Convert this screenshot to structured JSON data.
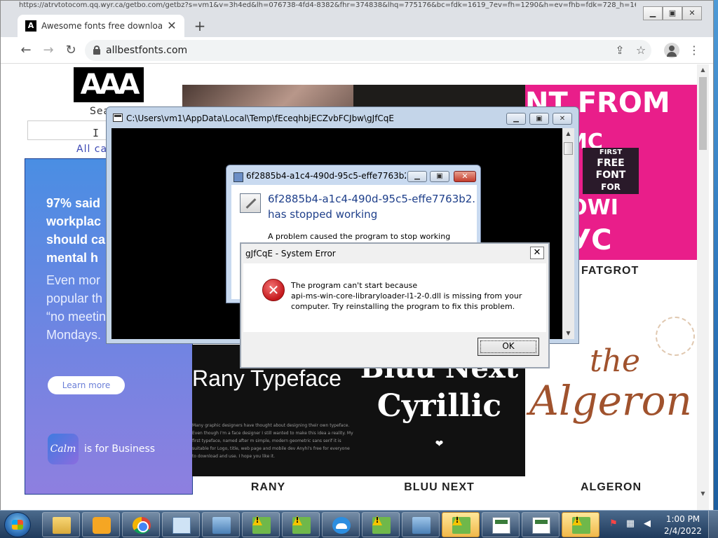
{
  "browser": {
    "address_bar_ghost": "https://atrvtotocom.qq.wyr.ca/getbo.com/getbz?s=vm1&v=3h4ed&lh=076738-4fd4-8382&fhr=374838&lhq=775176&bc=fdk=1619_7ev=fh=1290&h=ev=fhb=fdk=728_h=166-8f=h=f=470",
    "tab": {
      "favicon": "A",
      "title": "Awesome fonts free download -"
    },
    "url": "allbestfonts.com"
  },
  "webpage": {
    "logo": "AAA",
    "search_label": "Sea",
    "all_categories": "All ca",
    "ad": {
      "headline": [
        "97% said",
        "workplac",
        "should ca",
        "mental h"
      ],
      "body": [
        "Even mor",
        "popular th",
        "“no meetin",
        "Mondays."
      ],
      "cta": "Learn more",
      "logo_text": "Calm",
      "tagline": "is for Business"
    },
    "fonts": {
      "fatgrot": {
        "label": "FATGROT",
        "art_top": "NT FROM",
        "art_mid": "О ЦИС",
        "art_mid2": "ROWI",
        "art_bot": "ОРУС",
        "art_inner": [
          "FIRST",
          "FREE",
          "FONT",
          "FOR"
        ]
      },
      "rany": {
        "label": "RANY",
        "title": "Rany Typeface",
        "blurb": "Many graphic designers have thought about designing their own typeface. Even though I'm a face designer I still wanted to make this idea a reality. My first typeface, named after m simple, modern geometric sans serif it is suitable for Logo, title, web page and mobile dev Anyhi's free for everyone to download and use. I hope you like it."
      },
      "bluu": {
        "label": "BLUU NEXT",
        "title1": "Bluu Next",
        "title2": "Cyrillic",
        "heart": "❤"
      },
      "algeron": {
        "label": "ALGERON",
        "title1": "the",
        "title2": "Algeron"
      }
    }
  },
  "console_window": {
    "title": "C:\\Users\\vm1\\AppData\\Local\\Temp\\fEceqhbjECZvbFCJbw\\gJfCqE"
  },
  "stopped_dialog": {
    "title": "6f2885b4-a1c4-490d-95c5-effe7763b2ba....",
    "heading_line1": "6f2885b4-a1c4-490d-95c5-effe7763b2...",
    "heading_line2": "has stopped working",
    "text": "A problem caused the program to stop working"
  },
  "error_dialog": {
    "title": "gJfCqE - System Error",
    "message_lines": [
      "The program can't start because",
      "api-ms-win-core-libraryloader-l1-2-0.dll is missing from your",
      "computer. Try reinstalling the program to fix this problem."
    ],
    "ok_label": "OK",
    "icon": "error-x-icon"
  },
  "taskbar": {
    "items": [
      {
        "name": "explorer",
        "icon": "folder-icon",
        "active": false
      },
      {
        "name": "media-player",
        "icon": "media-player-icon",
        "active": false
      },
      {
        "name": "chrome",
        "icon": "chrome-icon",
        "active": false
      },
      {
        "name": "control-panel",
        "icon": "control-panel-icon",
        "active": false
      },
      {
        "name": "network",
        "icon": "network-icon",
        "active": false
      },
      {
        "name": "app-1",
        "icon": "warning-app-icon",
        "active": false
      },
      {
        "name": "app-2",
        "icon": "warning-app-icon",
        "active": false
      },
      {
        "name": "cloud",
        "icon": "cloud-icon",
        "active": false
      },
      {
        "name": "app-3",
        "icon": "warning-app-icon",
        "active": false
      },
      {
        "name": "remote",
        "icon": "network-icon",
        "active": false
      },
      {
        "name": "app-4",
        "icon": "warning-app-icon",
        "active": true
      },
      {
        "name": "doc-1",
        "icon": "document-icon",
        "active": false
      },
      {
        "name": "doc-2",
        "icon": "document-icon",
        "active": false
      },
      {
        "name": "app-5",
        "icon": "warning-app-icon",
        "active": true
      }
    ],
    "clock_time": "1:00 PM",
    "clock_date": "2/4/2022"
  }
}
